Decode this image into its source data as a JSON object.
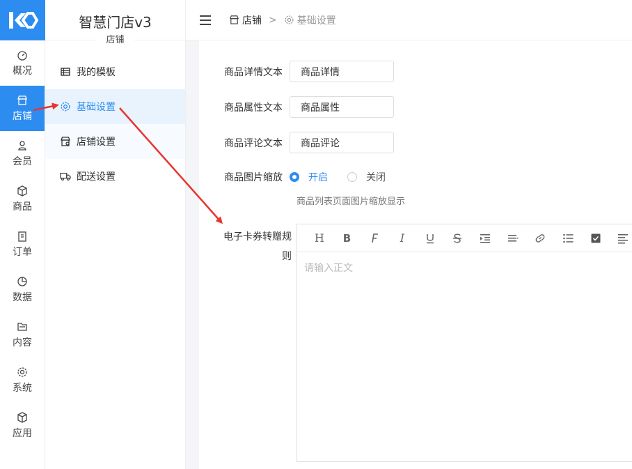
{
  "brand": {
    "title": "智慧门店v3",
    "subtitle": "店铺"
  },
  "rail": [
    {
      "label": "概况",
      "icon": "dashboard-icon"
    },
    {
      "label": "店铺",
      "icon": "store-icon",
      "active": true
    },
    {
      "label": "会员",
      "icon": "user-icon"
    },
    {
      "label": "商品",
      "icon": "box-icon"
    },
    {
      "label": "订单",
      "icon": "clipboard-icon"
    },
    {
      "label": "数据",
      "icon": "pie-chart-icon"
    },
    {
      "label": "内容",
      "icon": "folder-icon"
    },
    {
      "label": "系统",
      "icon": "gear-icon"
    },
    {
      "label": "应用",
      "icon": "cube-icon"
    }
  ],
  "subnav": [
    {
      "label": "我的模板",
      "icon": "table-icon"
    },
    {
      "label": "基础设置",
      "icon": "gear-icon",
      "active": true
    },
    {
      "label": "店铺设置",
      "icon": "shop-settings-icon"
    },
    {
      "label": "配送设置",
      "icon": "truck-icon"
    }
  ],
  "breadcrumb": {
    "root": "店铺",
    "separator": ">",
    "current": "基础设置"
  },
  "form": {
    "detail_label": "商品详情文本",
    "detail_value": "商品详情",
    "attr_label": "商品属性文本",
    "attr_value": "商品属性",
    "review_label": "商品评论文本",
    "review_value": "商品评论",
    "zoom_label": "商品图片缩放",
    "zoom_on": "开启",
    "zoom_off": "关闭",
    "zoom_selected": "开启",
    "zoom_hint": "商品列表页面图片缩放显示",
    "rule_label_1": "电子卡券转赠规",
    "rule_label_2": "则",
    "editor_placeholder": "请输入正文"
  },
  "editor_toolbar": [
    "heading-icon",
    "bold-icon",
    "font-icon",
    "italic-icon",
    "underline-icon",
    "strikethrough-icon",
    "indent-icon",
    "align-icon",
    "link-icon",
    "list-icon",
    "checkbox-icon",
    "justify-icon"
  ],
  "colors": {
    "accent": "#2d8cf0",
    "arrow": "#e8352e",
    "active_bg": "#e8f3fe"
  }
}
